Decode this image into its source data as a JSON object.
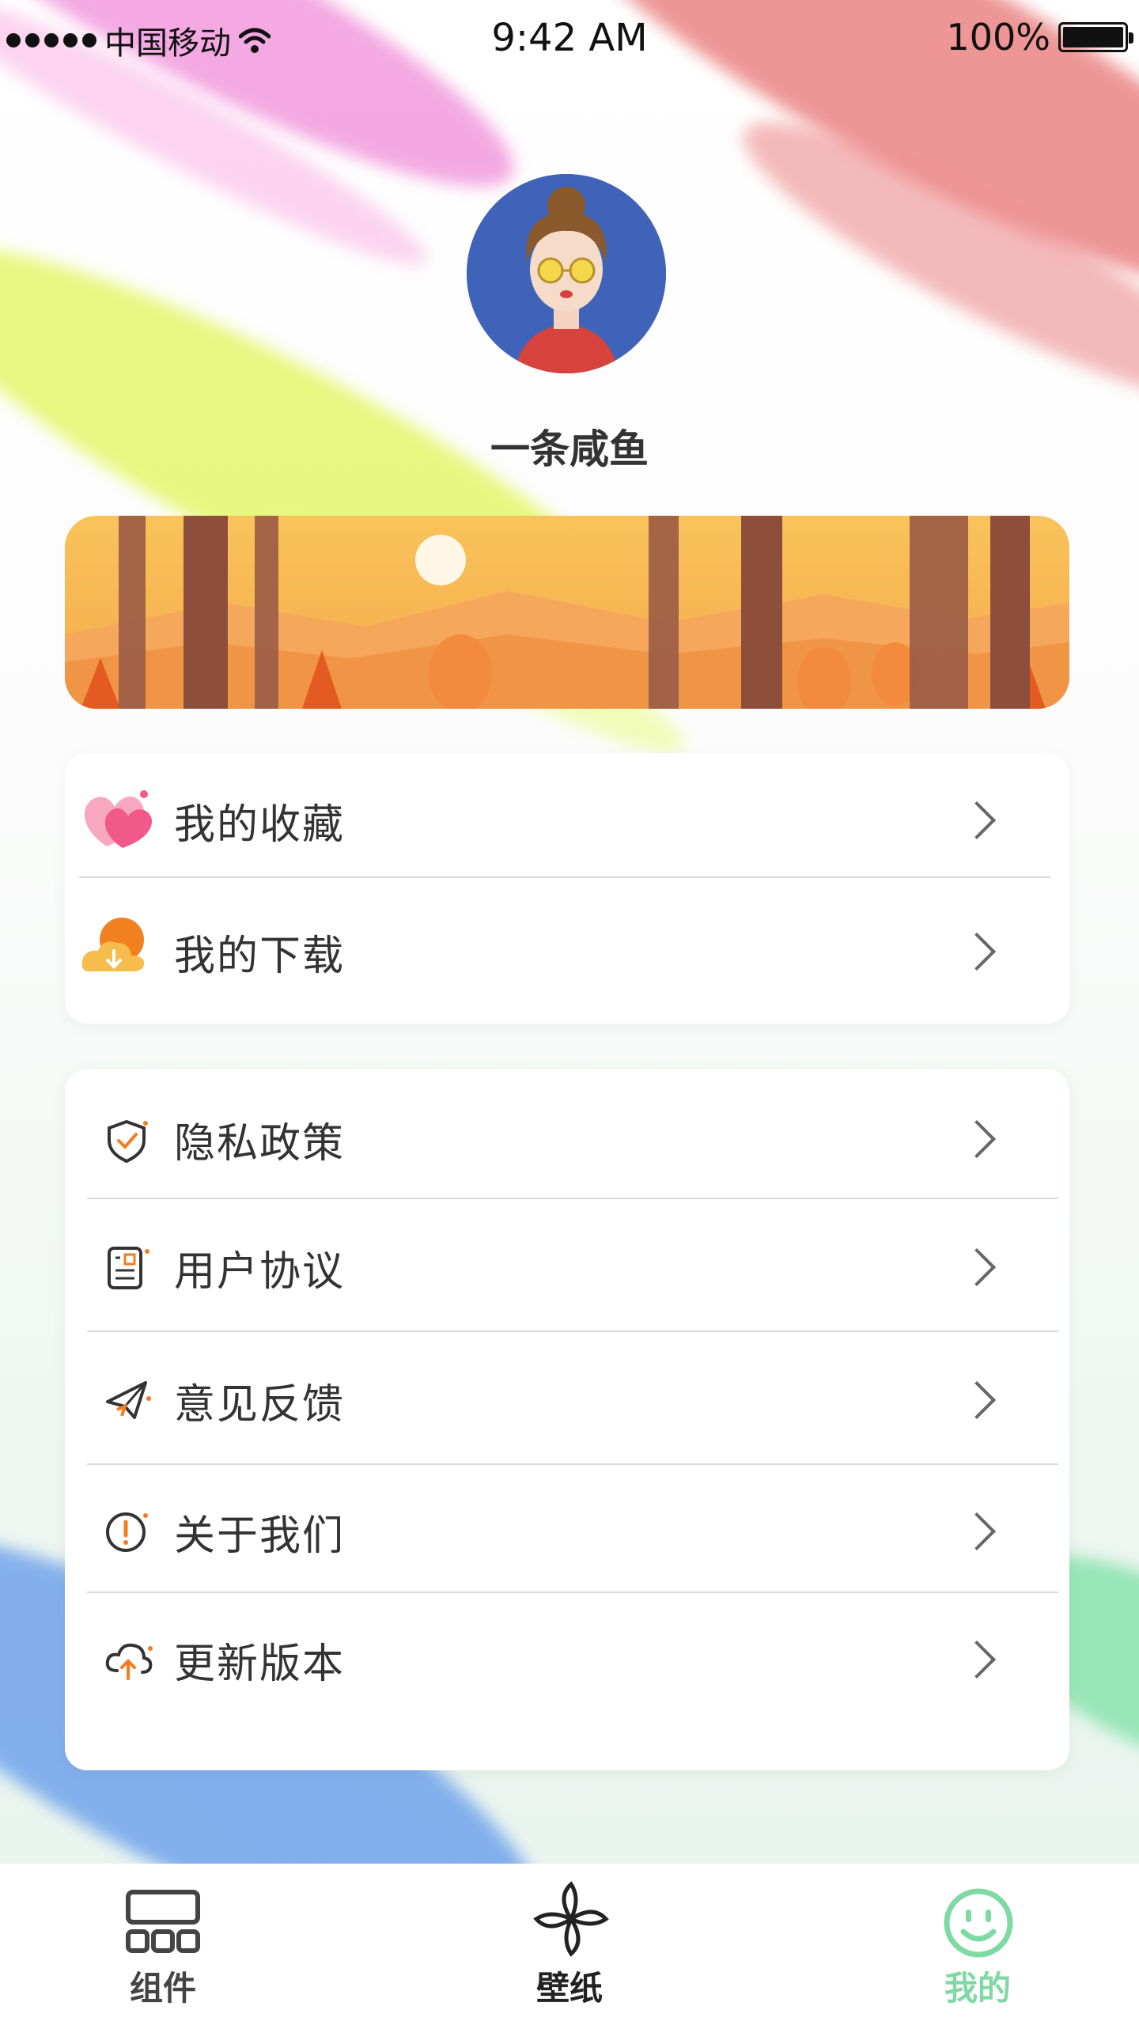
{
  "status_bar": {
    "carrier": "中国移动",
    "time": "9:42 AM",
    "battery": "100%"
  },
  "profile": {
    "username": "一条咸鱼"
  },
  "quick_list": [
    {
      "label": "我的收藏",
      "icon": "heart-icon"
    },
    {
      "label": "我的下载",
      "icon": "download-cloud-icon"
    }
  ],
  "settings_list": [
    {
      "label": "隐私政策",
      "icon": "shield-check-icon"
    },
    {
      "label": "用户协议",
      "icon": "document-icon"
    },
    {
      "label": "意见反馈",
      "icon": "paper-plane-icon"
    },
    {
      "label": "关于我们",
      "icon": "info-circle-icon"
    },
    {
      "label": "更新版本",
      "icon": "cloud-upload-icon"
    }
  ],
  "tabs": [
    {
      "label": "组件",
      "icon": "grid-icon",
      "active": false
    },
    {
      "label": "壁纸",
      "icon": "pinwheel-icon",
      "active": false
    },
    {
      "label": "我的",
      "icon": "smiley-icon",
      "active": true
    }
  ],
  "colors": {
    "accent_green": "#7ed9a3",
    "icon_orange": "#f47b20",
    "text": "#333333"
  }
}
